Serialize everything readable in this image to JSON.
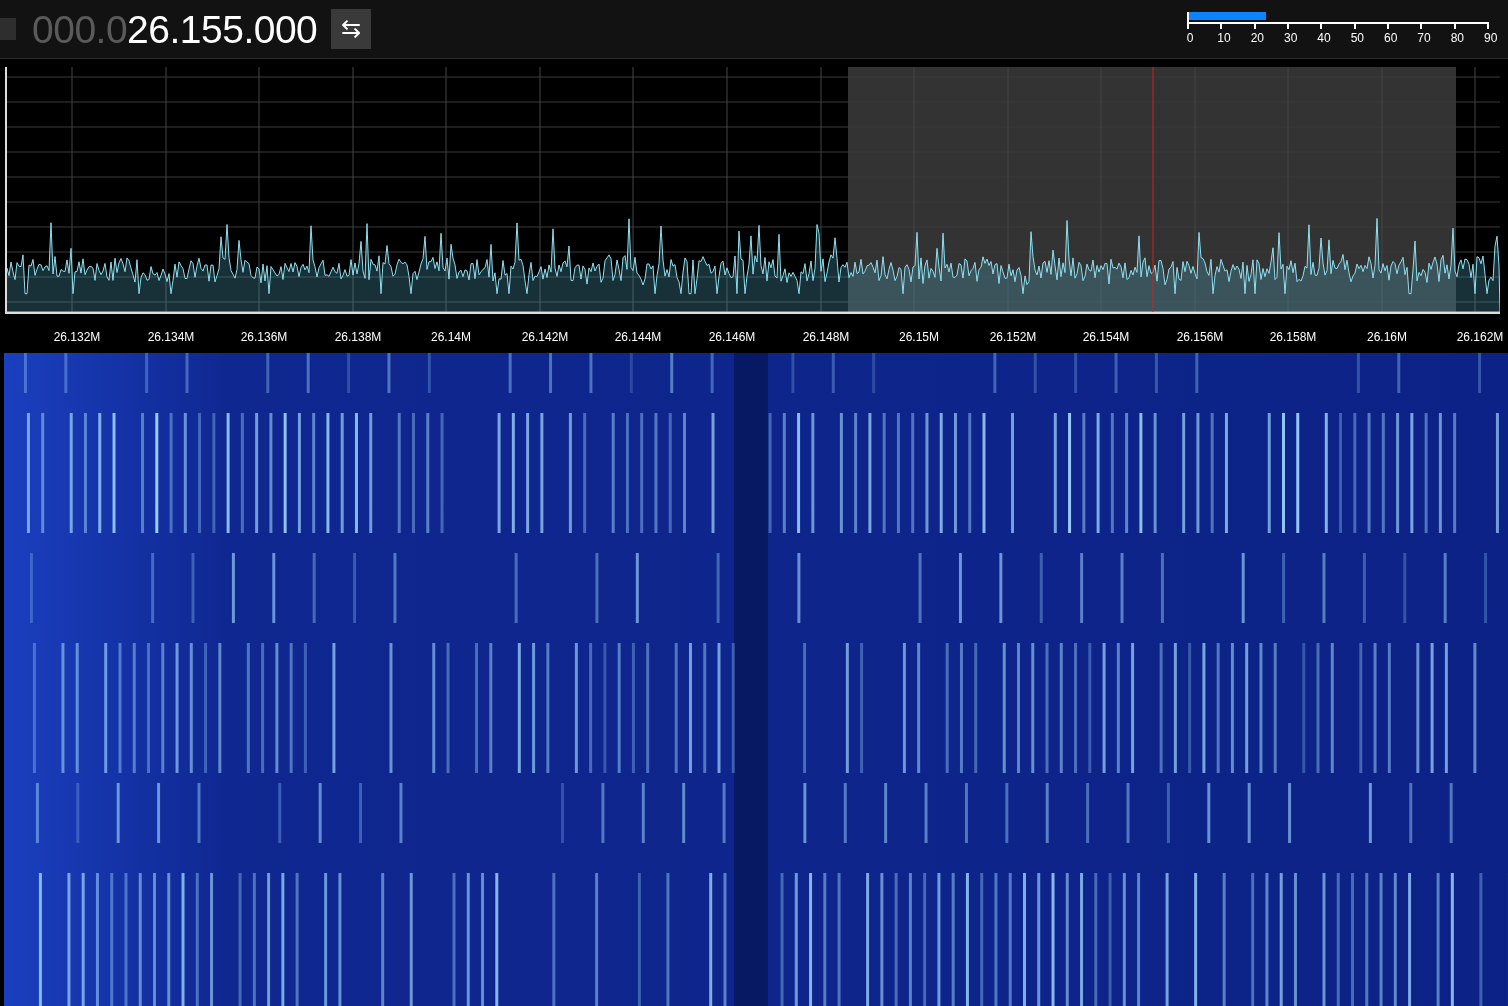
{
  "frequency": {
    "dim_digits": "000.0",
    "digits": "26.155.000"
  },
  "swap_button": {
    "label": "⇆"
  },
  "signal_meter": {
    "level": 0.255,
    "scale": [
      "0",
      "10",
      "20",
      "30",
      "40",
      "50",
      "60",
      "70",
      "80",
      "90"
    ]
  },
  "spectrum": {
    "frequency_labels": [
      "26.132M",
      "26.134M",
      "26.136M",
      "26.138M",
      "26.14M",
      "26.142M",
      "26.144M",
      "26.146M",
      "26.148M",
      "26.15M",
      "26.152M",
      "26.154M",
      "26.156M",
      "26.158M",
      "26.16M",
      "26.162M"
    ]
  }
}
